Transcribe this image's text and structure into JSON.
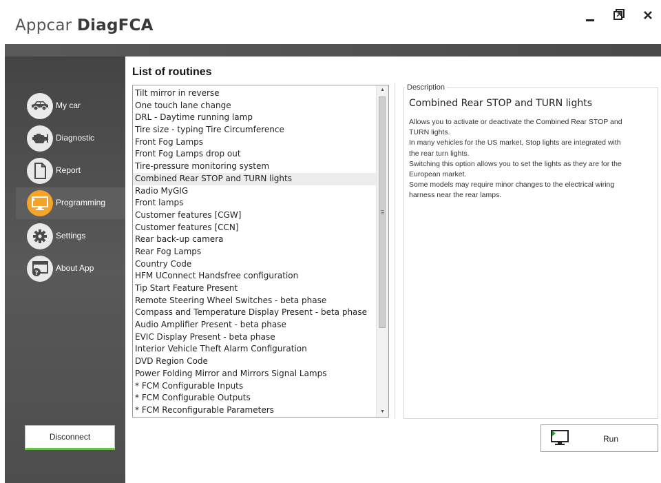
{
  "app": {
    "title_light": "Appcar ",
    "title_bold": "DiagFCA"
  },
  "sidebar": {
    "items": [
      {
        "label": "My car",
        "icon": "car-icon"
      },
      {
        "label": "Diagnostic",
        "icon": "engine-icon"
      },
      {
        "label": "Report",
        "icon": "document-icon"
      },
      {
        "label": "Programming",
        "icon": "monitor-icon",
        "active": true
      },
      {
        "label": "Settings",
        "icon": "gear-icon"
      },
      {
        "label": "About App",
        "icon": "help-window-icon"
      }
    ],
    "disconnect_label": "Disconnect"
  },
  "main": {
    "title": "List of routines",
    "routines": [
      "Tilt mirror in reverse",
      "One touch lane change",
      "DRL - Daytime running lamp",
      "Tire size - typing Tire Circumference",
      "Front Fog Lamps",
      "Front Fog Lamps drop out",
      "Tire-pressure monitoring system",
      "Combined Rear STOP and TURN lights",
      "Radio MyGIG",
      "Front lamps",
      "Customer features [CGW]",
      "Customer features [CCN]",
      "Rear back-up camera",
      "Rear Fog Lamps",
      "Country Code",
      "HFM UConnect Handsfree configuration",
      "Tip Start Feature Present",
      "Remote Steering Wheel Switches - beta phase",
      "Compass and Temperature Display Present - beta phase",
      "Audio Amplifier Present - beta phase",
      "EVIC Display Present - beta phase",
      "Interior Vehicle Theft Alarm Configuration",
      "DVD Region Code",
      "Power Folding Mirror and Mirrors Signal Lamps",
      "* FCM Configurable Inputs",
      "* FCM Configurable Outputs",
      "* FCM Reconfigurable Parameters"
    ],
    "selected_index": 7
  },
  "description": {
    "legend": "Description",
    "heading": "Combined Rear STOP and TURN lights",
    "lines": [
      "Allows you to activate or deactivate the Combined Rear STOP and",
      "TURN lights.",
      "In many vehicles for the US market, Stop lights are integrated with",
      "the rear turn lights.",
      "Switching this option allows you to set the lights as they are for the",
      "European market.",
      "Some models may require minor changes to the electrical wiring",
      "harness near the rear lamps."
    ]
  },
  "run": {
    "label": "Run",
    "icon": "monitor-play-icon"
  },
  "colors": {
    "accent": "#f4a429",
    "connected": "#6cc24a",
    "run_icon": "#2aa02a"
  }
}
